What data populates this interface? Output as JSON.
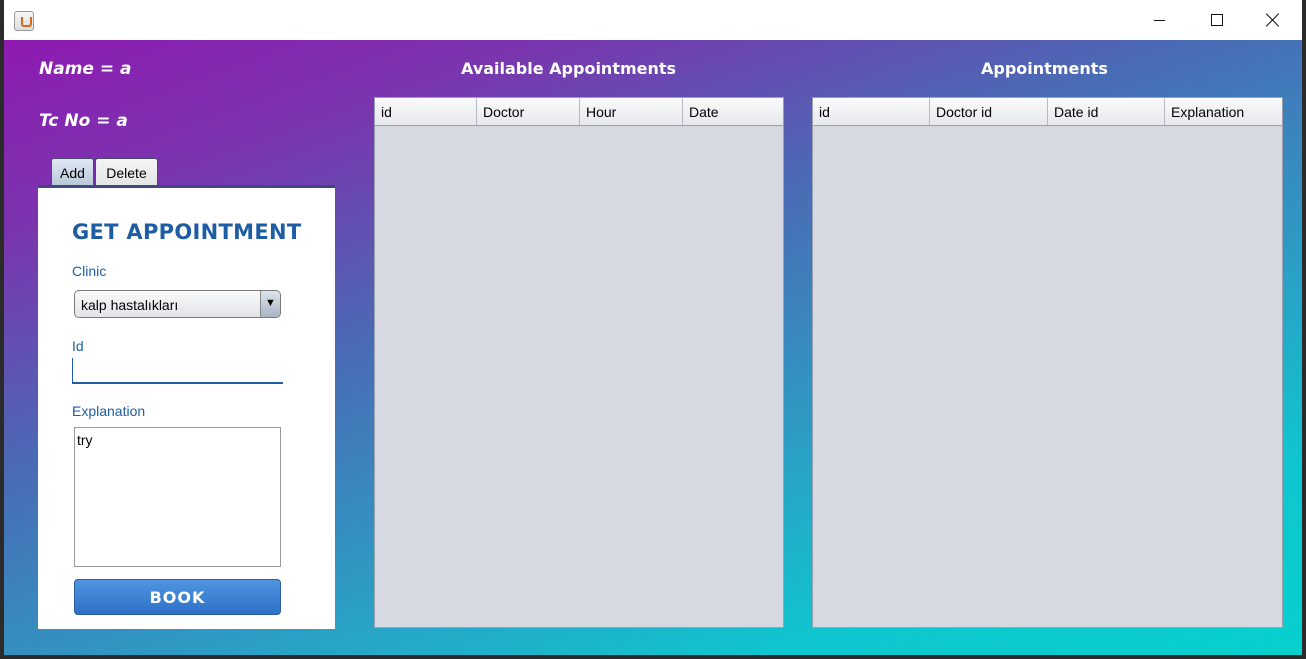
{
  "window": {
    "minimize_icon": "minimize-icon",
    "maximize_icon": "maximize-icon",
    "close_icon": "close-icon"
  },
  "user": {
    "name_label": "Name = a",
    "tc_label": "Tc No = a"
  },
  "tabs": [
    {
      "label": "Add",
      "selected": true
    },
    {
      "label": "Delete",
      "selected": false
    }
  ],
  "form": {
    "title": "GET APPOINTMENT",
    "clinic_label": "Clinic",
    "clinic_value": "kalp hastalıkları",
    "clinic_arrow": "▼",
    "id_label": "Id",
    "id_value": "",
    "explanation_label": "Explanation",
    "explanation_value": "try",
    "book_label": "BOOK"
  },
  "available": {
    "title": "Available Appointments",
    "columns": [
      "id",
      "Doctor",
      "Hour",
      "Date"
    ],
    "rows": []
  },
  "appointments": {
    "title": "Appointments",
    "columns": [
      "id",
      "Doctor id",
      "Date id",
      "Explanation"
    ],
    "rows": []
  },
  "colors": {
    "gradient_start": "#8e1ab2",
    "gradient_end": "#06d0ce",
    "accent_blue": "#1f5da3",
    "button_blue": "#2e71c8",
    "table_bg": "#d6d9e2"
  }
}
